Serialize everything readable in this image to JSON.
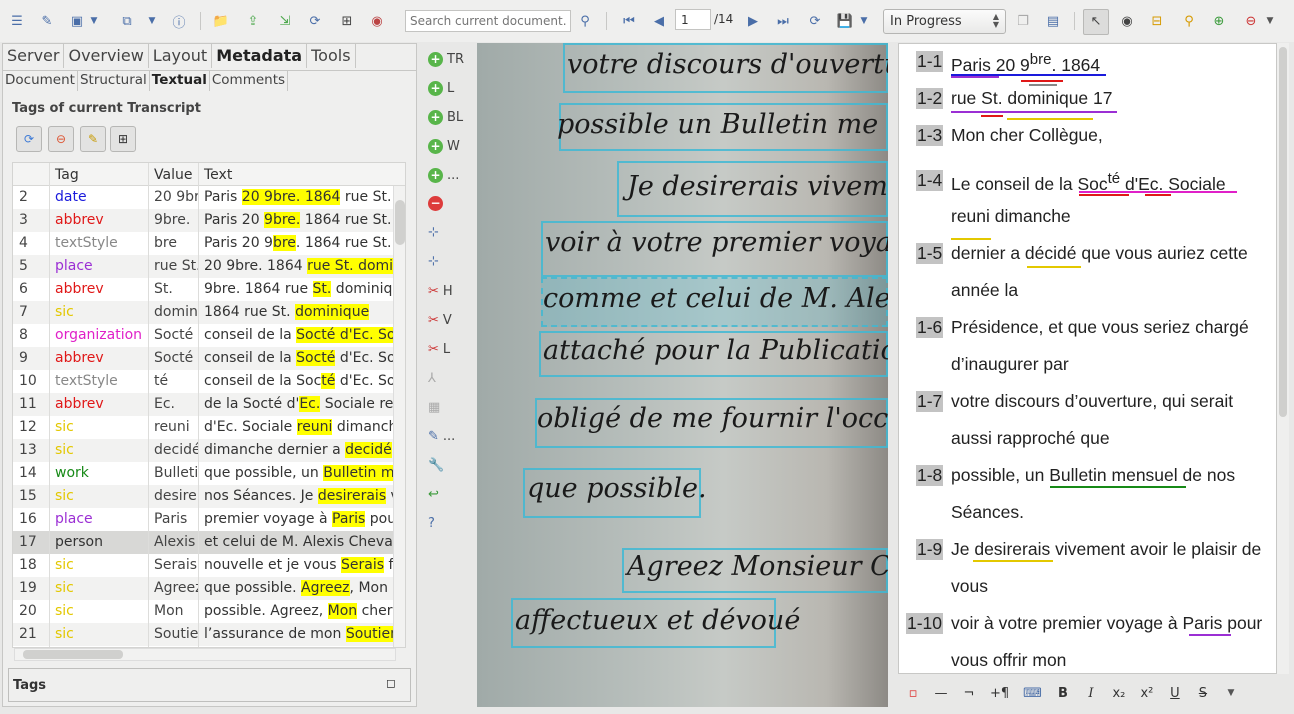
{
  "toolbar": {
    "search_placeholder": "Search current document...",
    "page_value": "1",
    "page_total": "/14",
    "status_label": "In Progress"
  },
  "left_panel": {
    "main_tabs": [
      "Server",
      "Overview",
      "Layout",
      "Metadata",
      "Tools"
    ],
    "active_main_tab": "Metadata",
    "sub_tabs": [
      "Document",
      "Structural",
      "Textual",
      "Comments"
    ],
    "active_sub_tab": "Textual",
    "section_title": "Tags of current Transcript",
    "table": {
      "headers": [
        "Tag",
        "Value",
        "Text"
      ],
      "rows": [
        {
          "n": "2",
          "tag": "date",
          "color": "#1a1adc",
          "value": "20 9bre.",
          "pre": "Paris ",
          "hl": "20 9bre. 1864",
          "post": " rue St. d"
        },
        {
          "n": "3",
          "tag": "abbrev",
          "color": "#e01818",
          "value": "9bre.",
          "pre": "Paris 20 ",
          "hl": "9bre.",
          "post": " 1864 rue St. d"
        },
        {
          "n": "4",
          "tag": "textStyle",
          "color": "#888888",
          "value": "bre",
          "pre": "Paris 20 9",
          "hl": "bre",
          "post": ". 1864 rue St."
        },
        {
          "n": "5",
          "tag": "place",
          "color": "#9b2fd4",
          "value": "rue St.",
          "pre": " 20 9bre. 1864 ",
          "hl": "rue St. domini",
          "post": ""
        },
        {
          "n": "6",
          "tag": "abbrev",
          "color": "#e01818",
          "value": "St.",
          "pre": " 9bre. 1864 rue ",
          "hl": "St.",
          "post": " dominique"
        },
        {
          "n": "7",
          "tag": "sic",
          "color": "#e3c800",
          "value": "domin",
          "pre": " 1864 rue St. ",
          "hl": "dominique",
          "post": ""
        },
        {
          "n": "8",
          "tag": "organization",
          "color": "#e020c8",
          "value": "Socté d",
          "pre": " conseil de la ",
          "hl": "Socté d'Ec. Soci",
          "post": ""
        },
        {
          "n": "9",
          "tag": "abbrev",
          "color": "#e01818",
          "value": "Socté",
          "pre": " conseil de la ",
          "hl": "Socté",
          "post": " d'Ec. Soci"
        },
        {
          "n": "10",
          "tag": "textStyle",
          "color": "#888888",
          "value": "té",
          "pre": " conseil de la Soc",
          "hl": "té",
          "post": " d'Ec. Soci"
        },
        {
          "n": "11",
          "tag": "abbrev",
          "color": "#e01818",
          "value": "Ec.",
          "pre": " de la Socté d'",
          "hl": "Ec.",
          "post": " Sociale reun"
        },
        {
          "n": "12",
          "tag": "sic",
          "color": "#e3c800",
          "value": "reuni",
          "pre": " d'Ec. Sociale ",
          "hl": "reuni",
          "post": " dimanche"
        },
        {
          "n": "13",
          "tag": "sic",
          "color": "#e3c800",
          "value": "decidé",
          "pre": " dimanche dernier a ",
          "hl": "decidé",
          "post": " q"
        },
        {
          "n": "14",
          "tag": "work",
          "color": "#178a17",
          "value": "Bulletin",
          "pre": " que possible, un ",
          "hl": "Bulletin men",
          "post": ""
        },
        {
          "n": "15",
          "tag": "sic",
          "color": "#e3c800",
          "value": "desirei",
          "pre": " nos Séances.  Je ",
          "hl": "desirerais",
          "post": " vi"
        },
        {
          "n": "16",
          "tag": "place",
          "color": "#9b2fd4",
          "value": "Paris",
          "pre": " premier voyage à ",
          "hl": "Paris",
          "post": " pour"
        },
        {
          "n": "17",
          "tag": "person",
          "color": "#333333",
          "value": "Alexis",
          "pre": " et celui de M. Alexis Chevalie",
          "hl": "",
          "post": ""
        },
        {
          "n": "18",
          "tag": "sic",
          "color": "#e3c800",
          "value": "Serais",
          "pre": " nouvelle et je vous ",
          "hl": "Serais",
          "post": " for"
        },
        {
          "n": "19",
          "tag": "sic",
          "color": "#e3c800",
          "value": "Agreez",
          "pre": " que possible.  ",
          "hl": "Agreez",
          "post": ", Mon c"
        },
        {
          "n": "20",
          "tag": "sic",
          "color": "#e3c800",
          "value": "Mon",
          "pre": " possible.  Agreez, ",
          "hl": "Mon",
          "post": " cher"
        },
        {
          "n": "21",
          "tag": "sic",
          "color": "#e3c800",
          "value": "Soutien",
          "pre": " l’assurance de mon ",
          "hl": "Soutien",
          "post": ""
        }
      ],
      "selected_row": "17"
    },
    "tags_box_label": "Tags"
  },
  "side_tools": [
    "TR",
    "L",
    "BL",
    "W",
    "...",
    "H",
    "V",
    "L",
    "..."
  ],
  "handwriting": [
    "votre discours d'ouverture, q",
    "possible un Bulletin me",
    "Je desirerais vivement",
    "voir à votre premier voyage",
    "comme et celui de M. Alex",
    "attaché pour la Publication ne",
    "obligé de me fournir l'occasio",
    "que possible.",
    "Agreez Monsieur Colle",
    "affectueux et dévoué"
  ],
  "transcript": [
    {
      "n": "1-1",
      "segments": [
        "Paris 20 9",
        "bre",
        ". 1864"
      ]
    },
    {
      "n": "1-2",
      "segments": [
        "rue St. dominique 17"
      ]
    },
    {
      "n": "1-3",
      "segments": [
        "Mon cher Collègue,"
      ]
    },
    {
      "n": "1-4",
      "segments": [
        "Le conseil de la Soc",
        "té",
        " d'Ec. Sociale"
      ]
    },
    {
      "n": "",
      "segments": [
        "reuni dimanche"
      ]
    },
    {
      "n": "1-5",
      "segments": [
        "dernier a décidé que vous auriez cette"
      ]
    },
    {
      "n": "",
      "segments": [
        "année la"
      ]
    },
    {
      "n": "1-6",
      "segments": [
        "Présidence, et que vous seriez chargé"
      ]
    },
    {
      "n": "",
      "segments": [
        "d’inaugurer par"
      ]
    },
    {
      "n": "1-7",
      "segments": [
        "votre discours d’ouverture, qui serait"
      ]
    },
    {
      "n": "",
      "segments": [
        "aussi rapproché que"
      ]
    },
    {
      "n": "1-8",
      "segments": [
        "possible, un Bulletin mensuel de nos"
      ]
    },
    {
      "n": "",
      "segments": [
        "Séances."
      ]
    },
    {
      "n": "1-9",
      "segments": [
        "Je desirerais vivement avoir le plaisir de"
      ]
    },
    {
      "n": "",
      "segments": [
        "vous"
      ]
    },
    {
      "n": "1-10",
      "segments": [
        "voir à votre premier voyage à Paris pour"
      ]
    },
    {
      "n": "",
      "segments": [
        "vous offrir mon"
      ]
    }
  ],
  "format_toolbar": [
    "—",
    "¬",
    "+¶",
    "B",
    "I",
    "x₂",
    "x²",
    "U",
    "S"
  ],
  "colors": {
    "place": "#9b2fd4",
    "date": "#1a1adc",
    "abbrev": "#e01818",
    "sic": "#e3c800",
    "organization": "#e020c8",
    "work": "#178a17",
    "textStyle": "#888888",
    "region": "#3fb9d3"
  }
}
